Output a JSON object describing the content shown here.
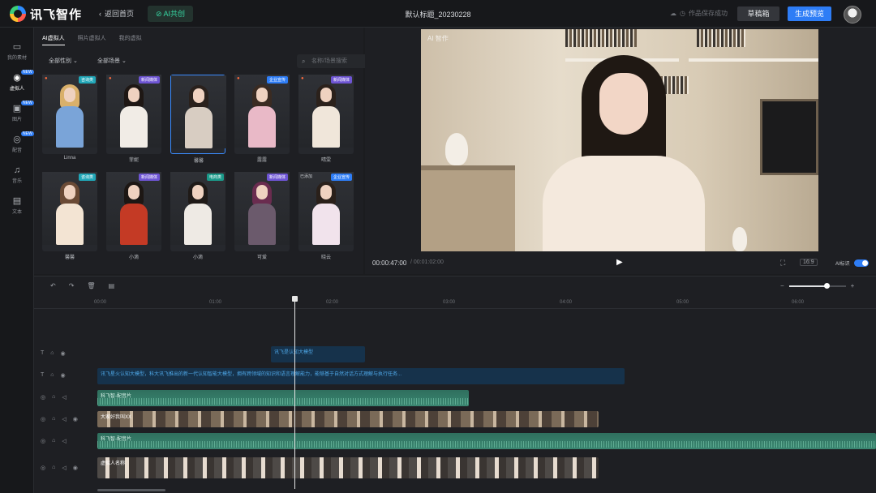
{
  "topbar": {
    "logo": "讯飞智作",
    "back_label": "返回首页",
    "ai_tab": "AI共创",
    "project_title": "默认标题_20230228",
    "sync_status": "作品保存成功",
    "draft_label": "草稿箱",
    "generate_label": "生成预览"
  },
  "leftnav": {
    "items": [
      {
        "label": "我的素材",
        "icon": "folder-icon",
        "badge": ""
      },
      {
        "label": "虚拟人",
        "icon": "avatar-icon",
        "badge": "NEW"
      },
      {
        "label": "图片",
        "icon": "image-icon",
        "badge": "NEW"
      },
      {
        "label": "配音",
        "icon": "voice-icon",
        "badge": "NEW"
      },
      {
        "label": "音乐",
        "icon": "music-icon",
        "badge": ""
      },
      {
        "label": "文本",
        "icon": "text-icon",
        "badge": ""
      }
    ]
  },
  "library": {
    "tabs": [
      "AI虚拟人",
      "照片虚拟人",
      "我的虚拟"
    ],
    "filter_gender": "全部性别",
    "filter_scene": "全部场景",
    "search_placeholder": "名称/场景搜索",
    "cards": [
      {
        "name": "Linna",
        "tag": "咨询类",
        "tag_color": "cyan",
        "hot": true,
        "hair": "#d9b06a",
        "body": "#7aa4d8"
      },
      {
        "name": "菲妮",
        "tag": "新闻媒体",
        "tag_color": "purple",
        "hot": true,
        "hair": "#1e1714",
        "body": "#f1ece6"
      },
      {
        "name": "馨馨",
        "tag": "",
        "tag_color": "",
        "hot": false,
        "hair": "#2a211c",
        "body": "#d8cdc2",
        "selected": true
      },
      {
        "name": "露露",
        "tag": "企业宣传",
        "tag_color": "blue",
        "hot": true,
        "hair": "#3a2b22",
        "body": "#e9b9c7"
      },
      {
        "name": "晴雯",
        "tag": "新闻媒体",
        "tag_color": "purple",
        "hot": true,
        "hair": "#2b211b",
        "body": "#f0e6da"
      },
      {
        "name": "馨馨",
        "tag": "咨询类",
        "tag_color": "cyan",
        "hot": false,
        "hair": "#6a4a35",
        "body": "#f3e4d3"
      },
      {
        "name": "小滴",
        "tag": "新闻媒体",
        "tag_color": "purple",
        "hot": false,
        "hair": "#1d1714",
        "body": "#c43a25"
      },
      {
        "name": "小滴",
        "tag": "电商类",
        "tag_color": "teal",
        "hot": false,
        "hair": "#1f1a17",
        "body": "#eeeae4"
      },
      {
        "name": "可爱",
        "tag": "新闻媒体",
        "tag_color": "purple",
        "hot": false,
        "hair": "#6a2c4f",
        "body": "#6b5a6c"
      },
      {
        "name": "晓云",
        "tag": "企业宣传",
        "tag_color": "blue",
        "hot": false,
        "hair": "#2a201a",
        "body": "#f1e3ec",
        "added": "已添加"
      }
    ]
  },
  "preview": {
    "watermark": "AI 智作",
    "current_time": "00:00:47:00",
    "total_time": "/ 00:01:02:00",
    "ratio": "16:9",
    "ai_mark_label": "AI标识"
  },
  "timeline": {
    "ruler": [
      "00:00",
      "01:00",
      "02:00",
      "03:00",
      "04:00",
      "05:00",
      "06:00"
    ],
    "clips": {
      "subtitle": "讯飞是认知大模型",
      "text": "讯飞星火认知大模型，科大讯飞推出的新一代认知智能大模型，拥有跨领域的知识和语言理解能力，能够基于自然对话方式理解与执行任务...",
      "audio1": "科飞智-配音片",
      "video": "大家好我叫XX",
      "audio2": "科飞智-配音片",
      "avatar": "虚拟人名称"
    }
  }
}
